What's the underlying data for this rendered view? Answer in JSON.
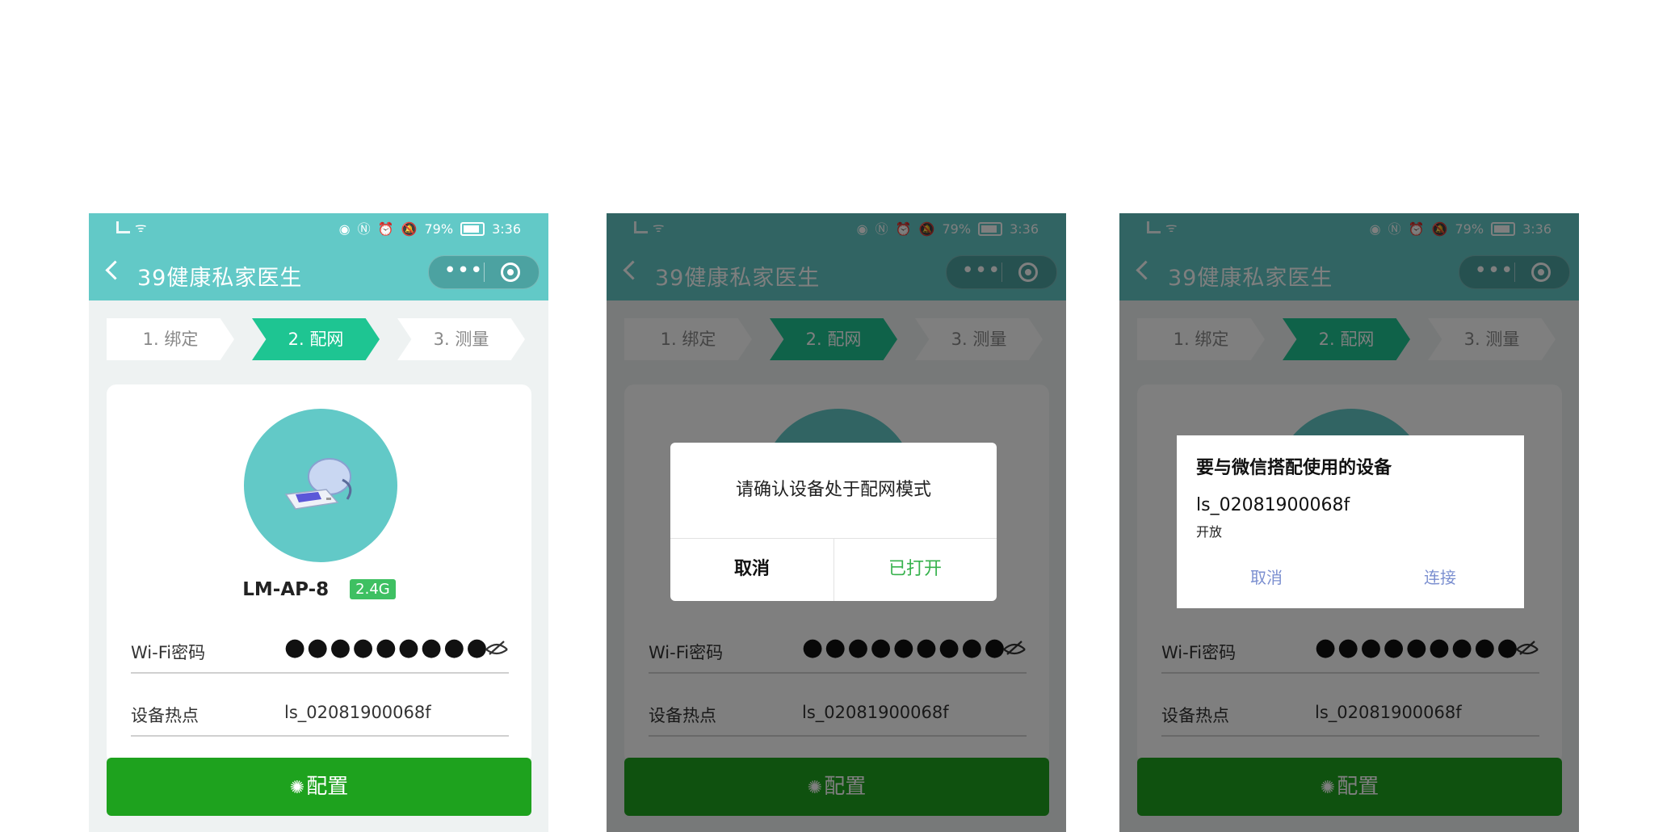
{
  "status_bar": {
    "battery_percent": "79%",
    "time": "3:36"
  },
  "app": {
    "title": "39健康私家医生",
    "more_glyph": "•••"
  },
  "steps": [
    {
      "label": "1. 绑定",
      "active": false
    },
    {
      "label": "2. 配网",
      "active": true
    },
    {
      "label": "3. 测量",
      "active": false
    }
  ],
  "device": {
    "name": "LM-AP-8",
    "band": "2.4G"
  },
  "form": {
    "wifi_password_label": "Wi-Fi密码",
    "wifi_password_masked": "●●●●●●●●●",
    "hotspot_label": "设备热点",
    "hotspot_value": "ls_02081900068f"
  },
  "config_button": {
    "label": "配置"
  },
  "dialog_confirm_mode": {
    "message": "请确认设备处于配网模式",
    "cancel": "取消",
    "confirm": "已打开"
  },
  "dialog_pair_device": {
    "title": "要与微信搭配使用的设备",
    "device_id": "ls_02081900068f",
    "device_status": "开放",
    "cancel": "取消",
    "connect": "连接"
  },
  "colors": {
    "header": "#62c9c7",
    "active_step": "#1ec592",
    "config_button": "#1ea21e",
    "badge": "#3ec062",
    "confirm_text": "#37b24d",
    "system_dialog_buttons": "#7b8fd0"
  }
}
